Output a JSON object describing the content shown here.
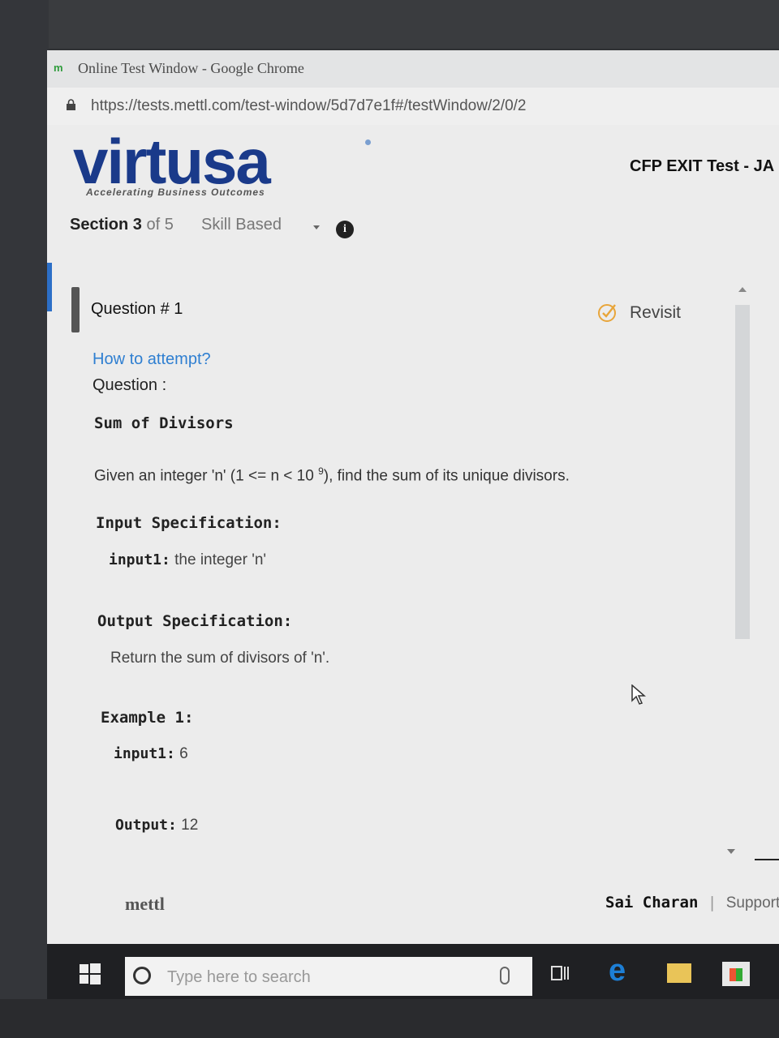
{
  "browser": {
    "app_logo": "m",
    "window_title": "Online Test Window - Google Chrome",
    "url": "https://tests.mettl.com/test-window/5d7d7e1f#/testWindow/2/0/2"
  },
  "header": {
    "brand": "virtusa",
    "tagline": "Accelerating Business Outcomes",
    "test_title": "CFP EXIT Test - JA"
  },
  "section": {
    "label_bold": "Section 3",
    "label_rest": " of 5",
    "dropdown_value": "Skill Based",
    "info_symbol": "i"
  },
  "question": {
    "number_label": "Question # 1",
    "revisit_label": "Revisit",
    "how_to_attempt": "How to attempt?",
    "heading": "Question :",
    "title": "Sum of Divisors",
    "body_before": "Given an integer 'n' (1 <= n < 10 ",
    "body_exp": "9",
    "body_after": "), find the sum of its unique divisors.",
    "input_spec_heading": "Input Specification:",
    "input_spec_key": "input1:",
    "input_spec_text": " the integer 'n'",
    "output_spec_heading": "Output Specification:",
    "output_spec_text": "Return the sum of divisors of 'n'.",
    "example_heading": "Example 1:",
    "example_input_key": "input1:",
    "example_input_value": " 6",
    "example_output_key": "Output:",
    "example_output_value": " 12"
  },
  "footer": {
    "mettl_logo": "mettl",
    "user_name": "Sai Charan",
    "separator": " | ",
    "support_label": "Support"
  },
  "taskbar": {
    "search_placeholder": "Type here to search",
    "edge_glyph": "e"
  }
}
